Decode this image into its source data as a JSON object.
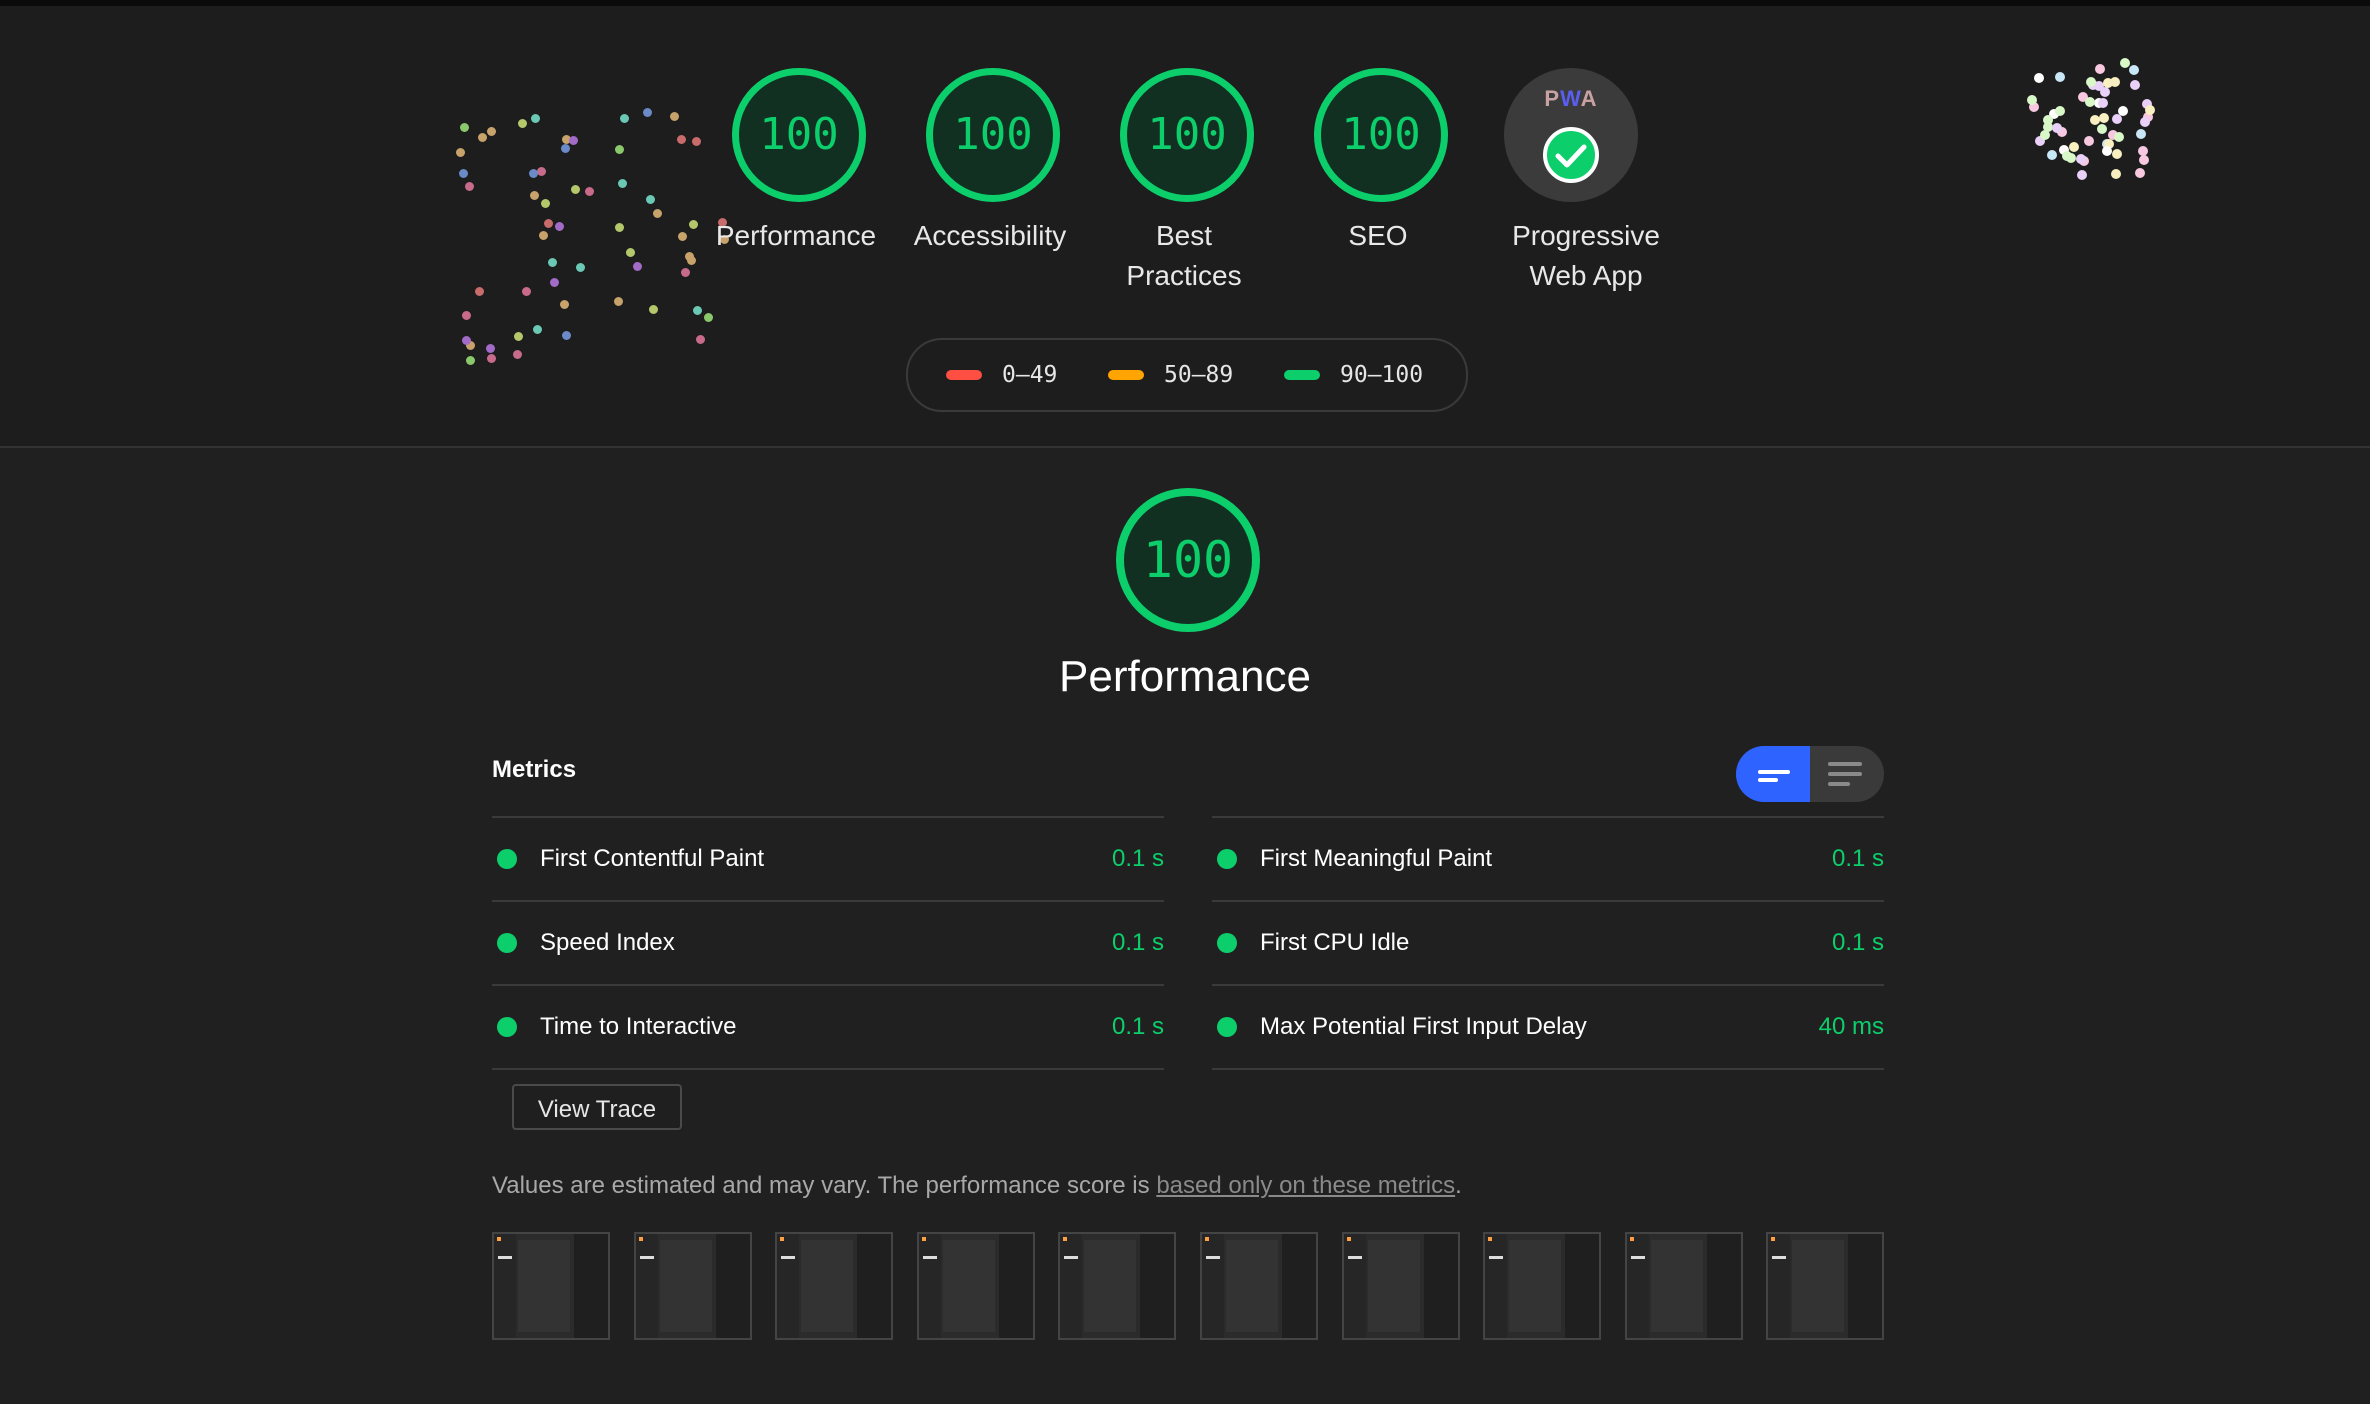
{
  "categories": [
    {
      "label": "Performance",
      "score": "100"
    },
    {
      "label": "Accessibility",
      "score": "100"
    },
    {
      "label": "Best Practices",
      "score": "100"
    },
    {
      "label": "SEO",
      "score": "100"
    },
    {
      "label": "Progressive Web App",
      "badge_text": "PWA",
      "badge_icon": "check-icon"
    }
  ],
  "legend": [
    {
      "range": "0–49",
      "color": "#ff4e42"
    },
    {
      "range": "50–89",
      "color": "#ffa400"
    },
    {
      "range": "90–100",
      "color": "#0cce6b"
    }
  ],
  "performance": {
    "score": "100",
    "title": "Performance",
    "metrics_heading": "Metrics",
    "view_toggle_icons": [
      "condensed-view-icon",
      "expanded-view-icon"
    ],
    "metrics_left": [
      {
        "name": "First Contentful Paint",
        "value": "0.1 s"
      },
      {
        "name": "Speed Index",
        "value": "0.1 s"
      },
      {
        "name": "Time to Interactive",
        "value": "0.1 s"
      }
    ],
    "metrics_right": [
      {
        "name": "First Meaningful Paint",
        "value": "0.1 s"
      },
      {
        "name": "First CPU Idle",
        "value": "0.1 s"
      },
      {
        "name": "Max Potential First Input Delay",
        "value": "40 ms"
      }
    ],
    "view_trace_label": "View Trace",
    "note_prefix": "Values are estimated and may vary. The performance score is ",
    "note_link": "based only on these metrics",
    "note_suffix": ".",
    "filmstrip_count": 10
  },
  "colors": {
    "pass": "#0cce6b",
    "toggle_active": "#2f63ff",
    "background": "#202020"
  }
}
